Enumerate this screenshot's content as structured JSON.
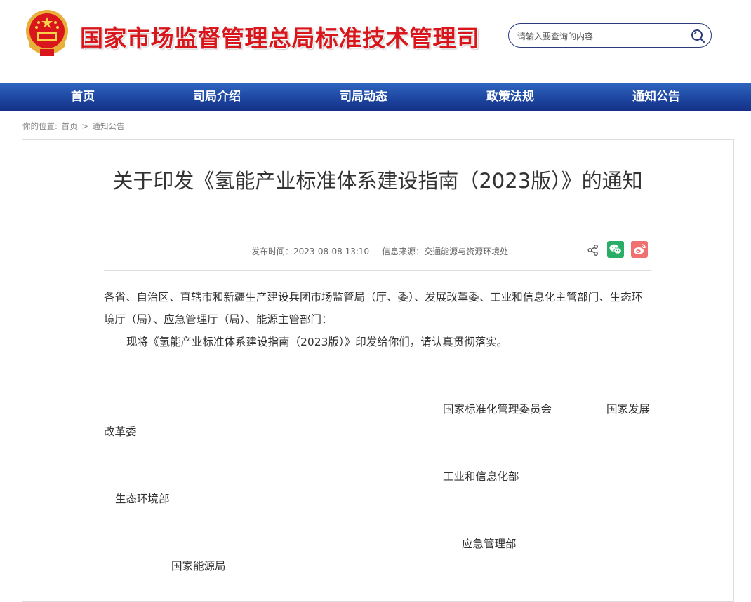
{
  "header": {
    "site_title": "国家市场监督管理总局标准技术管理司",
    "search_placeholder": "请输入要查询的内容",
    "emblem_icon": "national-emblem-icon",
    "search_icon": "magnifier-icon"
  },
  "colors": {
    "title_red": "#d8161b",
    "nav_blue": "#1d46a0",
    "wechat_green": "#2aae67",
    "weibo_red": "#f0716f"
  },
  "nav": {
    "items": [
      "首页",
      "司局介绍",
      "司局动态",
      "政策法规",
      "通知公告"
    ]
  },
  "breadcrumb": {
    "prefix": "你的位置:",
    "home": "首页",
    "arrow": ">",
    "current": "通知公告"
  },
  "article": {
    "title": "关于印发《氢能产业标准体系建设指南（2023版）》的通知",
    "publish_label": "发布时间：",
    "publish_time": "2023-08-08 13:10",
    "source_label": "信息来源：",
    "source": "交通能源与资源环境处",
    "recipients": "各省、自治区、直辖市和新疆生产建设兵团市场监管局（厅、委）、发展改革委、工业和信息化主管部门、生态环境厅（局）、应急管理厅（局）、能源主管部门：",
    "body": "现将《氢能产业标准体系建设指南（2023版）》印发给你们，请认真贯彻落实。",
    "signatories": {
      "sac": "国家标准化管理委员会",
      "ndrc_part1": "国家发展",
      "ndrc_part2": "改革委",
      "miit": "工业和信息化部",
      "mee": "生态环境部",
      "mem": "应急管理部",
      "nea": "国家能源局"
    }
  },
  "share": {
    "share_icon": "share-icon",
    "wechat_icon": "wechat-icon",
    "weibo_icon": "weibo-icon"
  }
}
